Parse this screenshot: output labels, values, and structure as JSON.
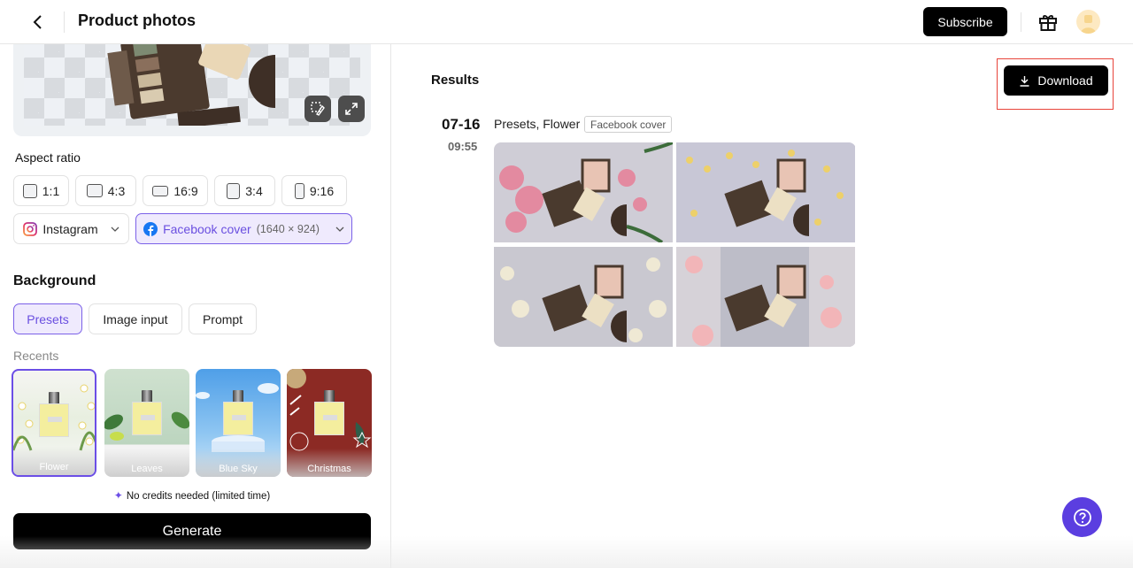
{
  "header": {
    "title": "Product photos",
    "subscribe_label": "Subscribe",
    "icons": [
      "chevron-left-icon",
      "gift-icon",
      "avatar"
    ]
  },
  "left_panel": {
    "preview_tools": [
      "erase-selection-icon",
      "expand-icon"
    ],
    "aspect_ratio": {
      "label": "Aspect ratio",
      "options": [
        {
          "label": "1:1",
          "selected": false
        },
        {
          "label": "4:3",
          "selected": false
        },
        {
          "label": "16:9",
          "selected": false
        },
        {
          "label": "3:4",
          "selected": false
        },
        {
          "label": "9:16",
          "selected": false
        }
      ],
      "platforms": [
        {
          "label": "Instagram",
          "icon": "instagram-icon",
          "selected": false
        },
        {
          "label": "Facebook cover",
          "size": "(1640 × 924)",
          "icon": "facebook-icon",
          "selected": true
        }
      ]
    },
    "background": {
      "label": "Background",
      "tabs": [
        {
          "label": "Presets",
          "selected": true
        },
        {
          "label": "Image input",
          "selected": false
        },
        {
          "label": "Prompt",
          "selected": false
        }
      ],
      "recents_label": "Recents",
      "presets": [
        {
          "name": "Flower",
          "selected": true
        },
        {
          "name": "Leaves",
          "selected": false
        },
        {
          "name": "Blue Sky",
          "selected": false
        },
        {
          "name": "Christmas",
          "selected": false
        }
      ]
    },
    "credits_note": "No credits needed (limited time)",
    "generate_label": "Generate"
  },
  "results": {
    "title": "Results",
    "download_label": "Download",
    "generations": [
      {
        "date": "07-16",
        "time": "09:55",
        "description": "Presets, Flower",
        "tag": "Facebook cover",
        "images": [
          "pink flowers flatlay",
          "yellow flowers flatlay",
          "white flowers flatlay",
          "pink roses flatlay"
        ]
      }
    ]
  },
  "help_icon": "question-circle-icon"
}
